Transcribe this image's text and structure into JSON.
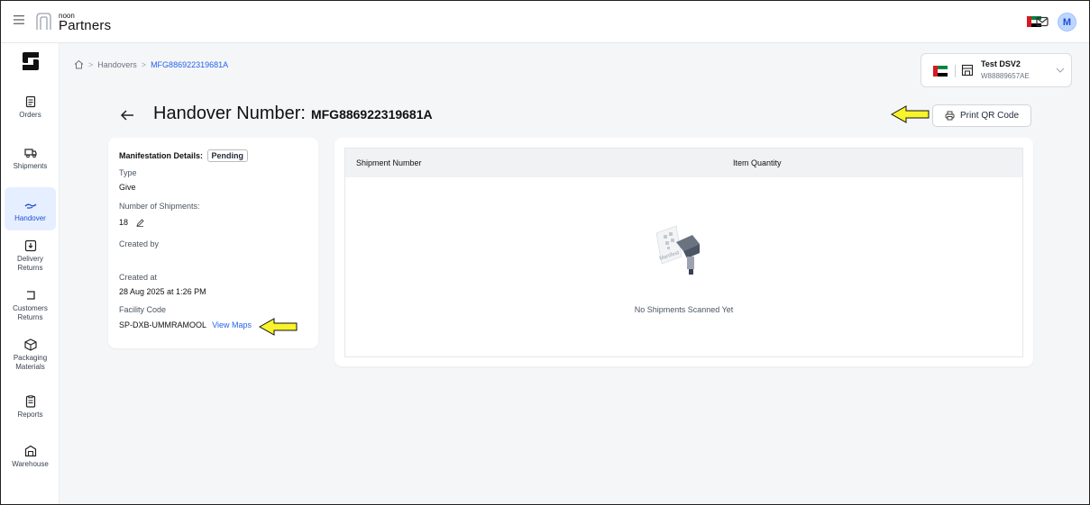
{
  "app": {
    "logo_small": "noon",
    "logo_text": "Partners",
    "avatar_initial": "M",
    "accent": "#2563eb"
  },
  "sidebar": {
    "items": [
      {
        "label": "Orders",
        "icon": "clipboard-icon"
      },
      {
        "label": "Shipments",
        "icon": "truck-icon"
      },
      {
        "label": "Handover",
        "icon": "handover-icon",
        "active": true
      },
      {
        "label": "Delivery Returns",
        "icon": "box-return-icon"
      },
      {
        "label": "Customers Returns",
        "icon": "return-icon"
      },
      {
        "label": "Packaging Materials",
        "icon": "package-icon"
      },
      {
        "label": "Reports",
        "icon": "report-icon"
      },
      {
        "label": "Warehouse",
        "icon": "warehouse-icon"
      }
    ]
  },
  "breadcrumb": {
    "items": [
      "Handovers",
      "MFG886922319681A"
    ]
  },
  "store": {
    "name": "Test DSV2",
    "id": "W88889657AE"
  },
  "page": {
    "title": "Handover Number:",
    "number": "MFG886922319681A",
    "print_label": "Print QR Code"
  },
  "details": {
    "manifestation_label": "Manifestation Details:",
    "status": "Pending",
    "type_label": "Type",
    "type_value": "Give",
    "shipments_label": "Number of Shipments:",
    "shipments_value": "18",
    "created_by_label": "Created by",
    "created_at_label": "Created at",
    "created_at_value": "28 Aug 2025 at 1:26 PM",
    "facility_label": "Facility Code",
    "facility_value": "SP-DXB-UMMRAMOOL",
    "view_maps": "View Maps"
  },
  "table": {
    "columns": [
      "Shipment Number",
      "Item Quantity"
    ],
    "empty_text": "No Shipments Scanned Yet",
    "illustration_text": "Manifest"
  }
}
